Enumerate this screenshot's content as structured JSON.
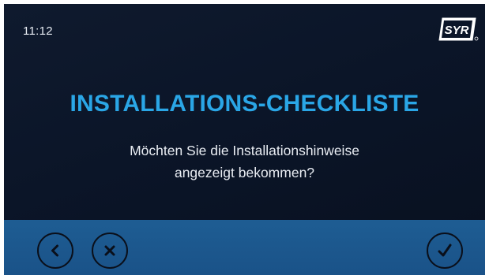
{
  "status": {
    "time": "11:12"
  },
  "brand": {
    "logo_text": "SYR",
    "icon": "syr-logo"
  },
  "dialog": {
    "title": "INSTALLATIONS-CHECKLISTE",
    "question_line1": "Möchten Sie die Installationshinweise",
    "question_line2": "angezeigt bekommen?"
  },
  "actions": {
    "back_icon": "chevron-left-icon",
    "cancel_icon": "close-icon",
    "confirm_icon": "checkmark-icon"
  },
  "colors": {
    "background": "#0b1528",
    "title": "#2aa6e6",
    "bottom_bar": "#1e5d93"
  }
}
